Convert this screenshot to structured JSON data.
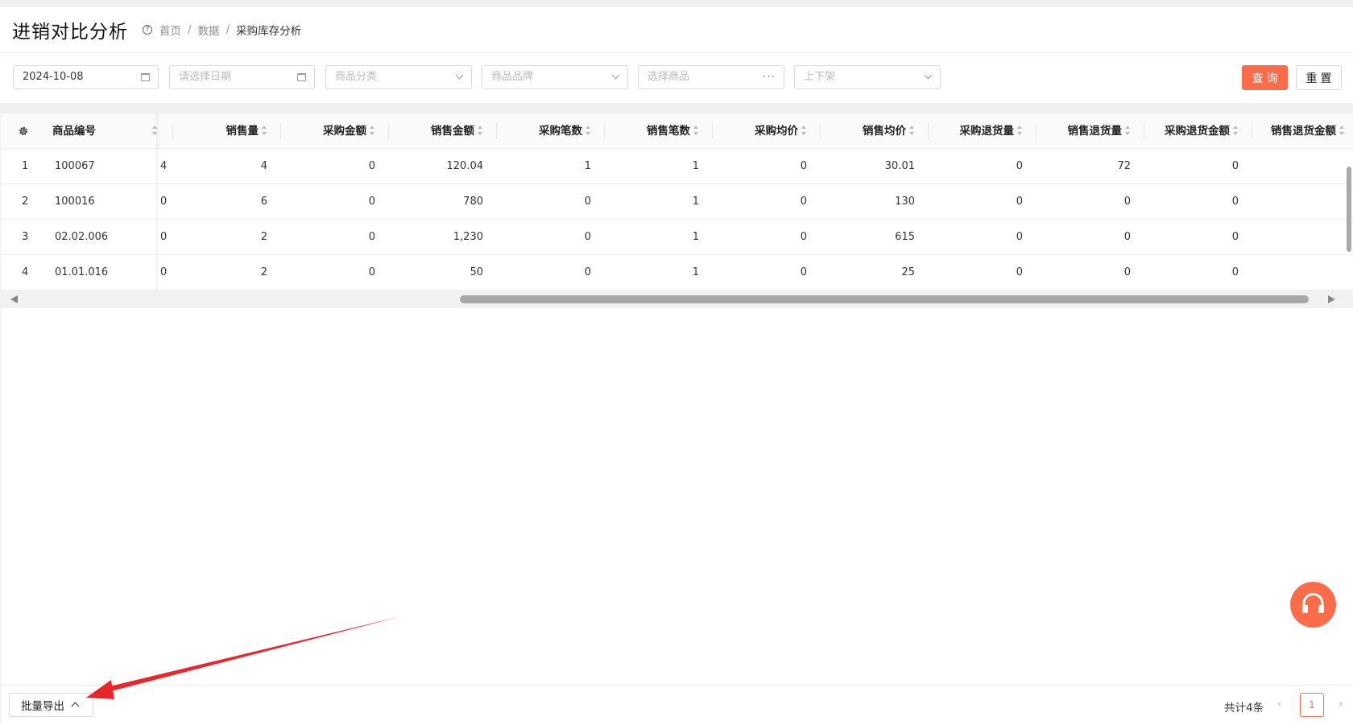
{
  "header": {
    "title": "进销对比分析",
    "breadcrumb": [
      "首页",
      "数据",
      "采购库存分析"
    ]
  },
  "filters": {
    "start_date": "2024-10-08",
    "end_date_placeholder": "请选择日期",
    "category_placeholder": "商品分类",
    "brand_placeholder": "商品品牌",
    "product_placeholder": "选择商品",
    "shelf_placeholder": "上下架",
    "query_label": "查询",
    "reset_label": "重置"
  },
  "table": {
    "columns": [
      "商品编号",
      "",
      "销售量",
      "采购金额",
      "销售金额",
      "采购笔数",
      "销售笔数",
      "采购均价",
      "销售均价",
      "采购退货量",
      "销售退货量",
      "采购退货金额",
      "销售退货金额"
    ],
    "rows": [
      [
        "1",
        "100067",
        "4",
        "4",
        "0",
        "120.04",
        "1",
        "1",
        "0",
        "30.01",
        "0",
        "72",
        "0"
      ],
      [
        "2",
        "100016",
        "0",
        "6",
        "0",
        "780",
        "0",
        "1",
        "0",
        "130",
        "0",
        "0",
        "0"
      ],
      [
        "3",
        "02.02.006",
        "0",
        "2",
        "0",
        "1,230",
        "0",
        "1",
        "0",
        "615",
        "0",
        "0",
        "0"
      ],
      [
        "4",
        "01.01.016",
        "0",
        "2",
        "0",
        "50",
        "0",
        "1",
        "0",
        "25",
        "0",
        "0",
        "0"
      ]
    ]
  },
  "footer": {
    "export_label": "批量导出",
    "total_text": "共计4条",
    "current_page": "1"
  },
  "icons": {
    "settings": "gear-icon",
    "service": "headset-icon",
    "prev": "chevron-left-icon",
    "next": "chevron-right-icon"
  },
  "colors": {
    "primary": "#fa6d4b",
    "annotation_arrow": "#e8262b"
  }
}
